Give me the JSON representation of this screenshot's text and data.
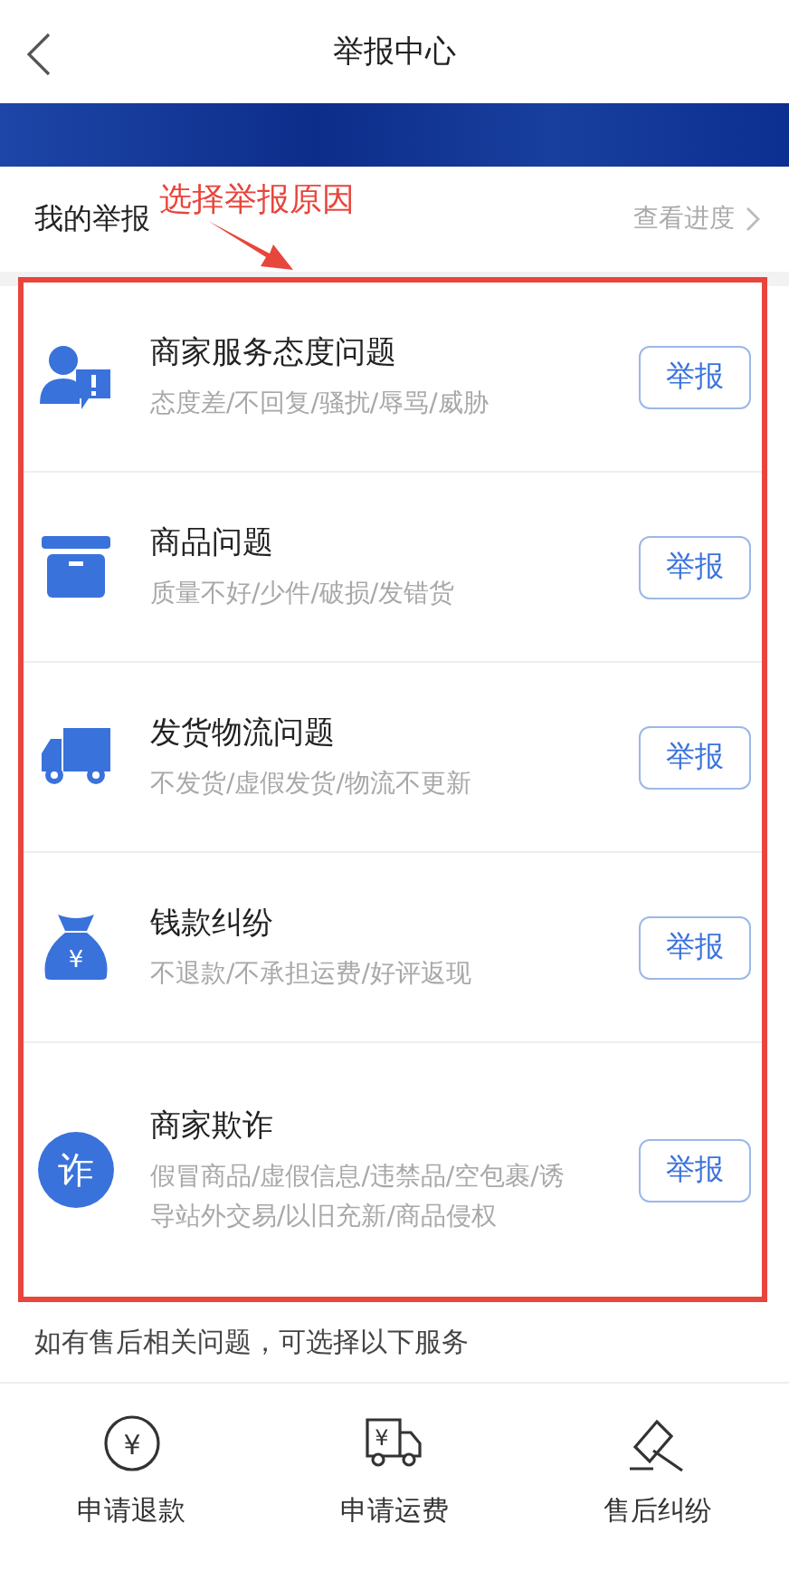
{
  "header": {
    "title": "举报中心"
  },
  "my_reports": {
    "label": "我的举报",
    "link": "查看进度"
  },
  "annotation": {
    "text": "选择举报原因"
  },
  "categories": [
    {
      "kind": "merchant",
      "title": "商家服务态度问题",
      "detail": "态度差/不回复/骚扰/辱骂/威胁",
      "button": "举报"
    },
    {
      "kind": "goods",
      "title": "商品问题",
      "detail": "质量不好/少件/破损/发错货",
      "button": "举报"
    },
    {
      "kind": "shipping",
      "title": "发货物流问题",
      "detail": "不发货/虚假发货/物流不更新",
      "button": "举报"
    },
    {
      "kind": "money",
      "icon_text": "¥",
      "title": "钱款纠纷",
      "detail": "不退款/不承担运费/好评返现",
      "button": "举报"
    },
    {
      "kind": "fraud",
      "icon_text": "诈",
      "title": "商家欺诈",
      "detail": "假冒商品/虚假信息/违禁品/空包裹/诱导站外交易/以旧充新/商品侵权",
      "button": "举报"
    }
  ],
  "services_hint": "如有售后相关问题，可选择以下服务",
  "services": [
    {
      "kind": "refund",
      "icon_text": "¥",
      "label": "申请退款"
    },
    {
      "kind": "freight",
      "icon_text": "¥",
      "label": "申请运费"
    },
    {
      "kind": "dispute",
      "label": "售后纠纷"
    }
  ]
}
